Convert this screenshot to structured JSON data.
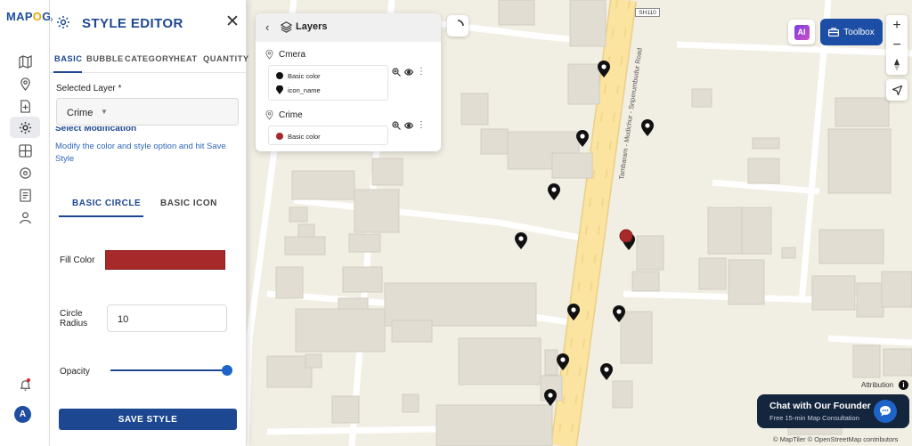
{
  "app": {
    "logo_main": "MAP",
    "logo_accent": "O",
    "logo_end": "G"
  },
  "rail": {
    "icons": [
      "map-icon",
      "location-pin-icon",
      "add-file-icon",
      "settings-icon",
      "layers-grid-icon",
      "process-icon",
      "report-icon",
      "user-map-icon"
    ],
    "bottom": {
      "bell": "bell-icon",
      "avatar_initial": "A"
    }
  },
  "editor": {
    "title": "STYLE EDITOR",
    "tabs": [
      "BASIC",
      "BUBBLE",
      "CATEGORY",
      "HEAT",
      "QUANTITY"
    ],
    "active_tab": "BASIC",
    "selected_layer_label": "Selected Layer *",
    "selected_layer_value": "Crime",
    "section_heading": "Select Modification",
    "section_desc": "Modify the color and style option and hit Save Style",
    "subtabs": [
      "BASIC CIRCLE",
      "BASIC ICON"
    ],
    "active_subtab": "BASIC CIRCLE",
    "fill_color_label": "Fill Color",
    "fill_color_value": "#a8292a",
    "circle_radius_label_1": "Circle",
    "circle_radius_label_2": "Radius",
    "circle_radius_value": "10",
    "opacity_label": "Opacity",
    "opacity_value": 1.0,
    "save_label": "SAVE STYLE"
  },
  "layers": {
    "title": "Layers",
    "items": [
      {
        "name": "Cmera",
        "entries": [
          {
            "swatch": "#111111",
            "label": "Basic color"
          },
          {
            "swatch": "pin",
            "label": "icon_name"
          }
        ]
      },
      {
        "name": "Crime",
        "entries": [
          {
            "swatch": "#a8292a",
            "label": "Basic color"
          }
        ]
      }
    ]
  },
  "map": {
    "road_label": "Tambaram - Mudichur - Sriperumbudur Road",
    "highway_badge": "SH110",
    "attribution": "Attribution",
    "copyright": "© MapTiler © OpenStreetMap contributors"
  },
  "toolbar": {
    "ai_label": "AI",
    "toolbox_label": "Toolbox"
  },
  "chat": {
    "title": "Chat with Our Founder",
    "subtitle": "Free 15-min Map Consultation"
  },
  "colors": {
    "accent": "#1d4891",
    "crime": "#a8292a",
    "camera": "#111111"
  }
}
